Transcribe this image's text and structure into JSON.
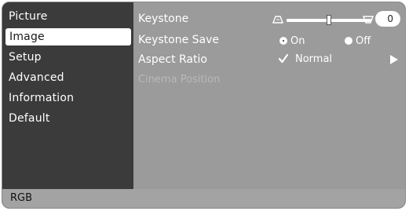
{
  "sidebar": {
    "items": [
      {
        "label": "Picture",
        "selected": false
      },
      {
        "label": "Image",
        "selected": true
      },
      {
        "label": "Setup",
        "selected": false
      },
      {
        "label": "Advanced",
        "selected": false
      },
      {
        "label": "Information",
        "selected": false
      },
      {
        "label": "Default",
        "selected": false
      }
    ]
  },
  "main": {
    "keystone": {
      "label": "Keystone",
      "value": "0",
      "level_fraction": 0.5,
      "left_icon": "keystone-narrow-icon",
      "right_icon": "keystone-wide-icon"
    },
    "keystone_save": {
      "label": "Keystone Save",
      "options": [
        {
          "label": "On",
          "checked": true
        },
        {
          "label": "Off",
          "checked": false
        }
      ]
    },
    "aspect_ratio": {
      "label": "Aspect Ratio",
      "value": "Normal",
      "icon": "checkmark-icon",
      "arrow_icon": "play-arrow-icon"
    },
    "cinema_position": {
      "label": "Cinema Position",
      "disabled": true
    }
  },
  "status_bar": {
    "text": "RGB"
  },
  "colors": {
    "sidebar_bg": "#3b3b3b",
    "main_bg": "#9b9b9b",
    "status_bg": "#a3a3a3",
    "selected_bg": "#ffffff",
    "text": "#ffffff"
  }
}
